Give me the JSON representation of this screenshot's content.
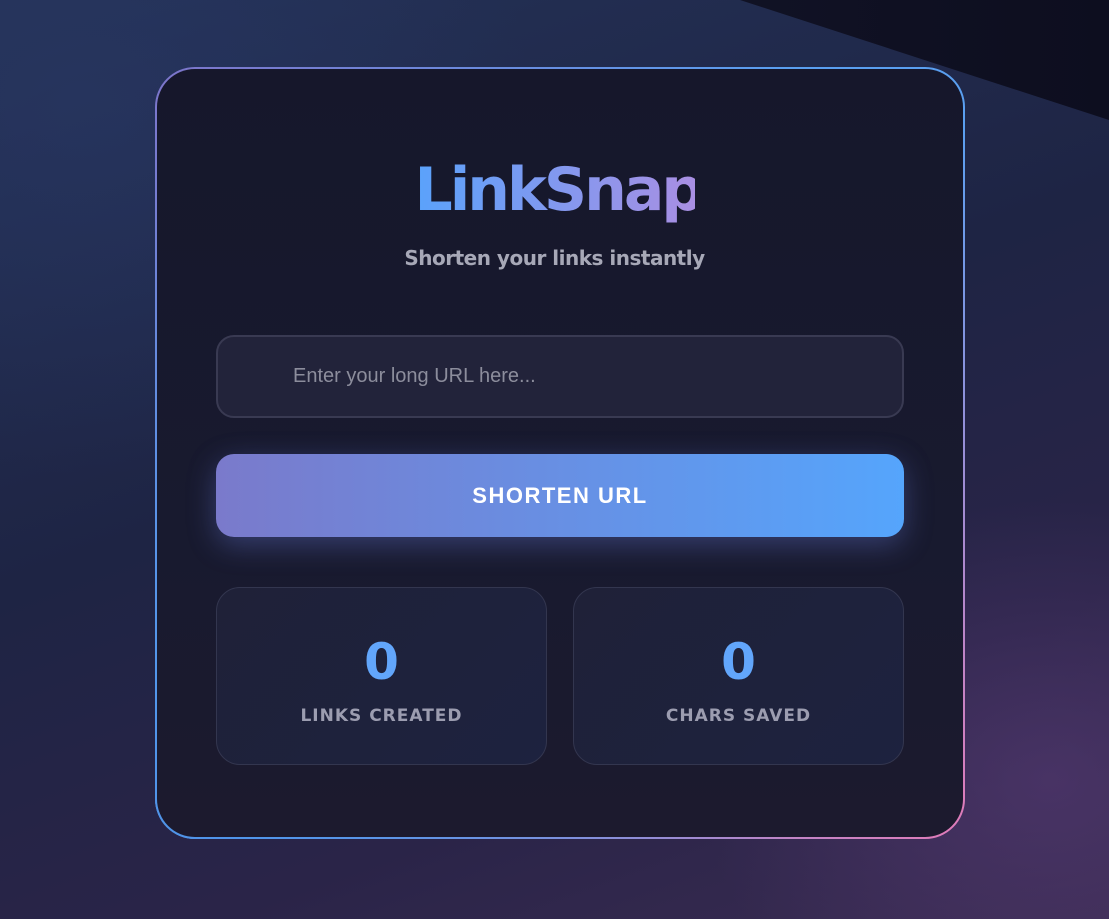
{
  "app": {
    "title": "LinkSnap",
    "tagline": "Shorten your links instantly"
  },
  "form": {
    "url_value": "",
    "url_placeholder": "Enter your long URL here...",
    "submit_label": "SHORTEN URL"
  },
  "stats": [
    {
      "value": "0",
      "label": "LINKS CREATED"
    },
    {
      "value": "0",
      "label": "CHARS SAVED"
    }
  ],
  "colors": {
    "accent_blue": "#5aa2fb",
    "accent_purple": "#a98fe3",
    "accent_pink": "#e27bb8"
  }
}
